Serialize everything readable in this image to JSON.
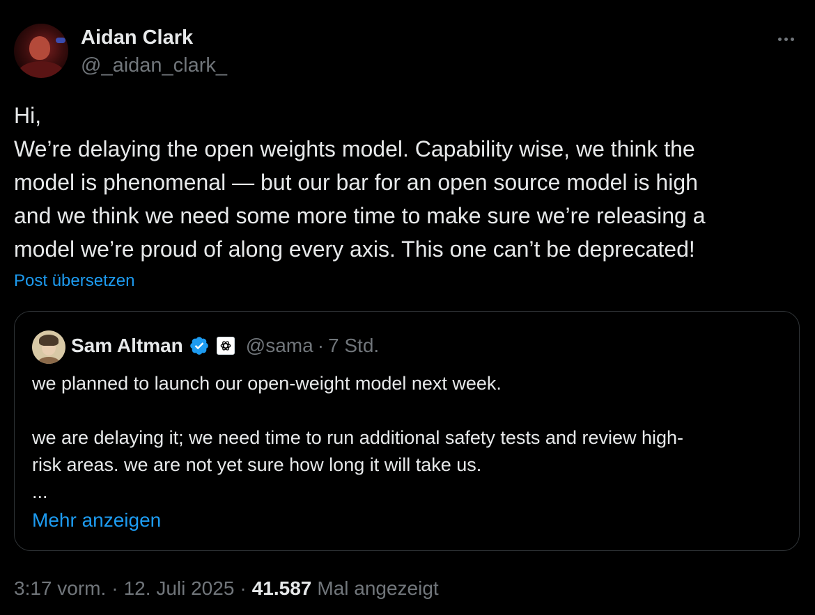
{
  "author": {
    "name": "Aidan Clark",
    "handle": "@_aidan_clark_"
  },
  "post": {
    "lines": [
      "Hi,",
      "We’re delaying the open weights model. Capability wise, we think the",
      "model is phenomenal — but our bar for an open source model is high",
      "and we think we need some more time to make sure we’re releasing a",
      "model we’re proud of along every axis. This one can’t be deprecated!"
    ],
    "translate_label": "Post übersetzen"
  },
  "quote": {
    "name": "Sam Altman",
    "handle": "@sama",
    "separator": "·",
    "time": "7 Std.",
    "lines": [
      "we planned to launch our open-weight model next week.",
      "",
      "we are delaying it; we need time to run additional safety tests and review high-",
      "risk areas. we are not yet sure how long it will take us.",
      "..."
    ],
    "show_more_label": "Mehr anzeigen",
    "verified_color": "#1d9bf0"
  },
  "meta": {
    "time": "3:17 vorm.",
    "separator1": "·",
    "date": "12. Juli 2025",
    "separator2": "·",
    "views_count": "41.587",
    "views_label": "Mal angezeigt"
  },
  "icons": {
    "more": "more-horizontal-icon",
    "verified": "verified-badge-icon",
    "affiliate": "openai-logo-icon"
  },
  "colors": {
    "background": "#000000",
    "text": "#e7e9ea",
    "secondary": "#71767b",
    "link": "#1d9bf0",
    "border": "#2f3336"
  }
}
